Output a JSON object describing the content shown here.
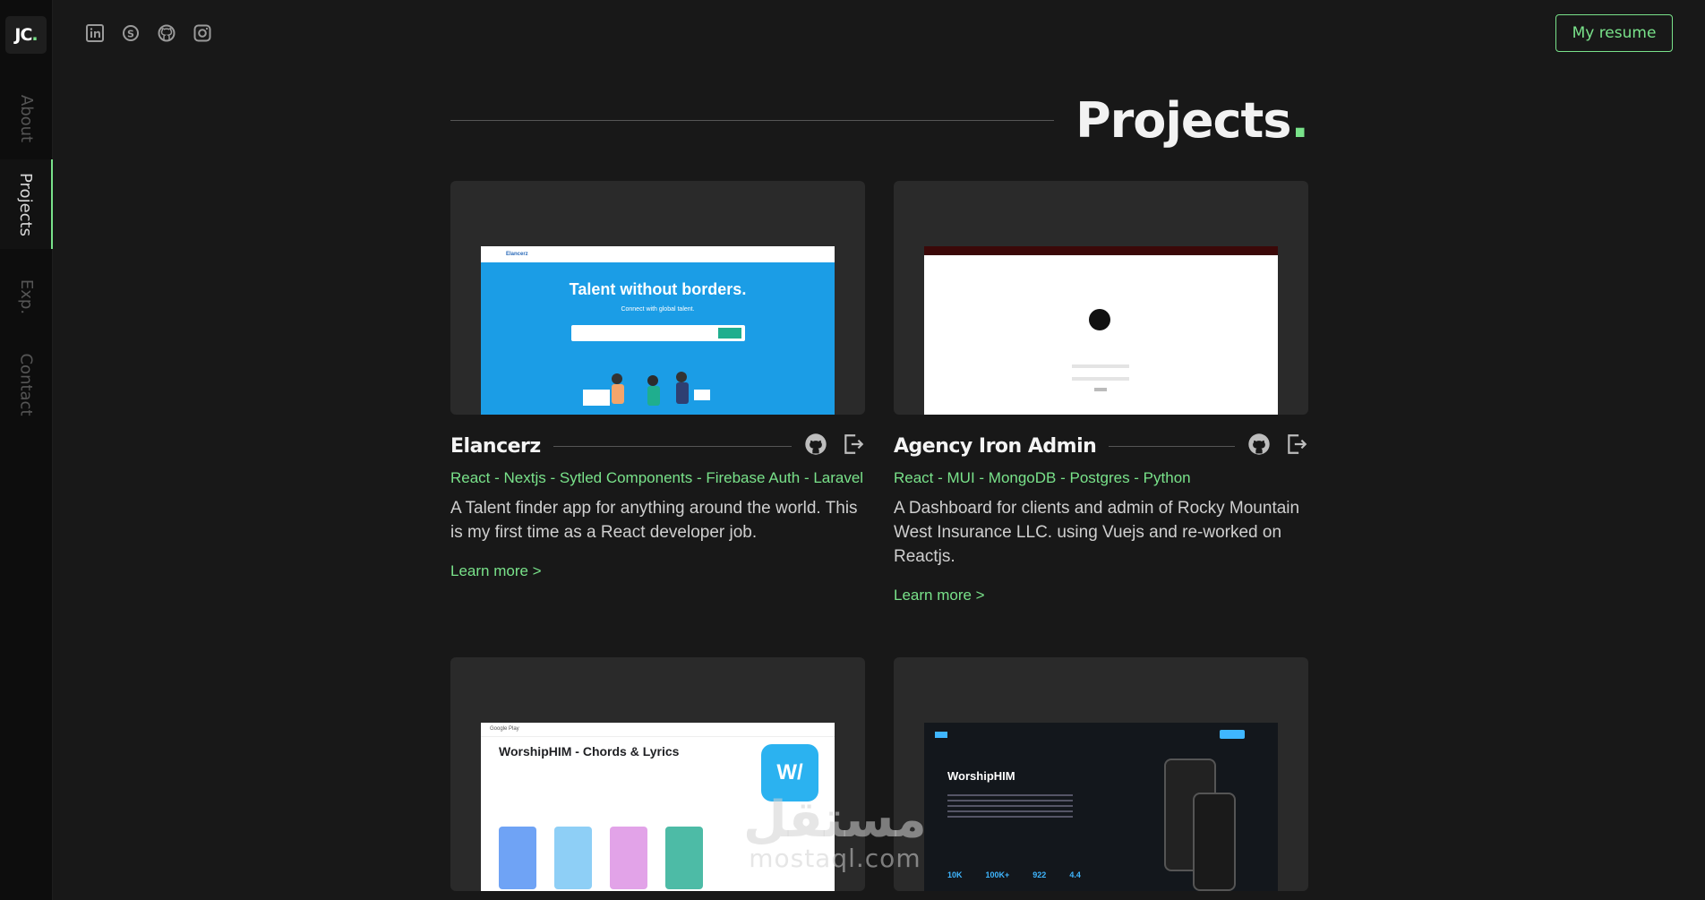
{
  "brand": {
    "logo_text": "JC",
    "logo_dot": "."
  },
  "sidebar": {
    "items": [
      {
        "label": "About",
        "active": false
      },
      {
        "label": "Projects",
        "active": true
      },
      {
        "label": "Exp.",
        "active": false
      },
      {
        "label": "Contact",
        "active": false
      }
    ]
  },
  "social": [
    "linkedin-icon",
    "skype-icon",
    "github-icon",
    "instagram-icon"
  ],
  "header": {
    "resume_label": "My resume"
  },
  "section": {
    "title": "Projects",
    "title_dot": "."
  },
  "projects": [
    {
      "title": "Elancerz",
      "tags": "React - Nextjs - Sytled Components - Firebase Auth - Laravel",
      "description": "A Talent finder app for anything around the world. This is my first time as a React developer job.",
      "more": "Learn more >",
      "shot": {
        "brand": "Elancerz",
        "headline": "Talent without borders.",
        "sub": "Connect with global talent."
      }
    },
    {
      "title": "Agency Iron Admin",
      "tags": "React - MUI - MongoDB - Postgres - Python",
      "description": "A Dashboard for clients and admin of Rocky Mountain West Insurance LLC. using Vuejs and re-worked on Reactjs.",
      "more": "Learn more >"
    },
    {
      "shot": {
        "store": "Google Play",
        "app_title": "WorshipHIM - Chords & Lyrics"
      }
    },
    {
      "shot": {
        "headline": "WorshipHIM",
        "stats": [
          "10K",
          "100K+",
          "922",
          "4.4"
        ]
      }
    }
  ],
  "watermark": {
    "arabic": "مستقل",
    "latin": "mostaql.com"
  },
  "colors": {
    "accent": "#79e28a",
    "background": "#181818",
    "sidebar": "#0d0d0d",
    "card": "#2a2a2a"
  }
}
